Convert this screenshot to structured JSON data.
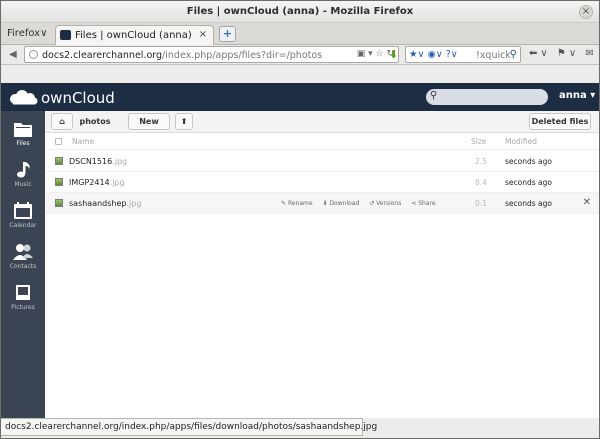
{
  "window": {
    "title": "Files | ownCloud (anna) - Mozilla Firefox",
    "close_glyph": "×"
  },
  "tabs": {
    "firefox_menu": "Firefox∨",
    "active_tab_label": "Files | ownCloud (anna)",
    "close_tab_glyph": "×",
    "new_tab_glyph": "+"
  },
  "navbar": {
    "url_host": "docs2.clearerchannel.org",
    "url_path": "/index.php/apps/files?dir=/photos",
    "search_placeholder": "!xquick",
    "search_engine_icon": "★∨ ◉∨ ?∨"
  },
  "owncloud": {
    "brand": "ownCloud",
    "user_menu": "anna ▾",
    "search_value": ""
  },
  "appnav": [
    {
      "label": "Files",
      "icon": "folder-icon"
    },
    {
      "label": "Music",
      "icon": "music-note-icon"
    },
    {
      "label": "Calendar",
      "icon": "calendar-icon"
    },
    {
      "label": "Contacts",
      "icon": "contacts-icon"
    },
    {
      "label": "Pictures",
      "icon": "pictures-icon"
    }
  ],
  "controls": {
    "breadcrumb": "photos",
    "new_button": "New",
    "deleted_files_button": "Deleted files"
  },
  "table": {
    "headers": {
      "name": "Name",
      "size": "Size",
      "modified": "Modified"
    },
    "rows": [
      {
        "name": "DSCN1516",
        "ext": ".jpg",
        "size": "2.5",
        "modified": "seconds ago"
      },
      {
        "name": "IMGP2414",
        "ext": ".jpg",
        "size": "8.4",
        "modified": "seconds ago"
      },
      {
        "name": "sashaandshep",
        "ext": ".jpg",
        "size": "0.1",
        "modified": "seconds ago"
      }
    ],
    "row_actions": {
      "rename": "Rename",
      "download": "Download",
      "versions": "Versions",
      "share": "Share"
    }
  },
  "statusbar": {
    "text": "docs2.clearerchannel.org/index.php/apps/files/download/photos/sashaandshep.jpg"
  }
}
